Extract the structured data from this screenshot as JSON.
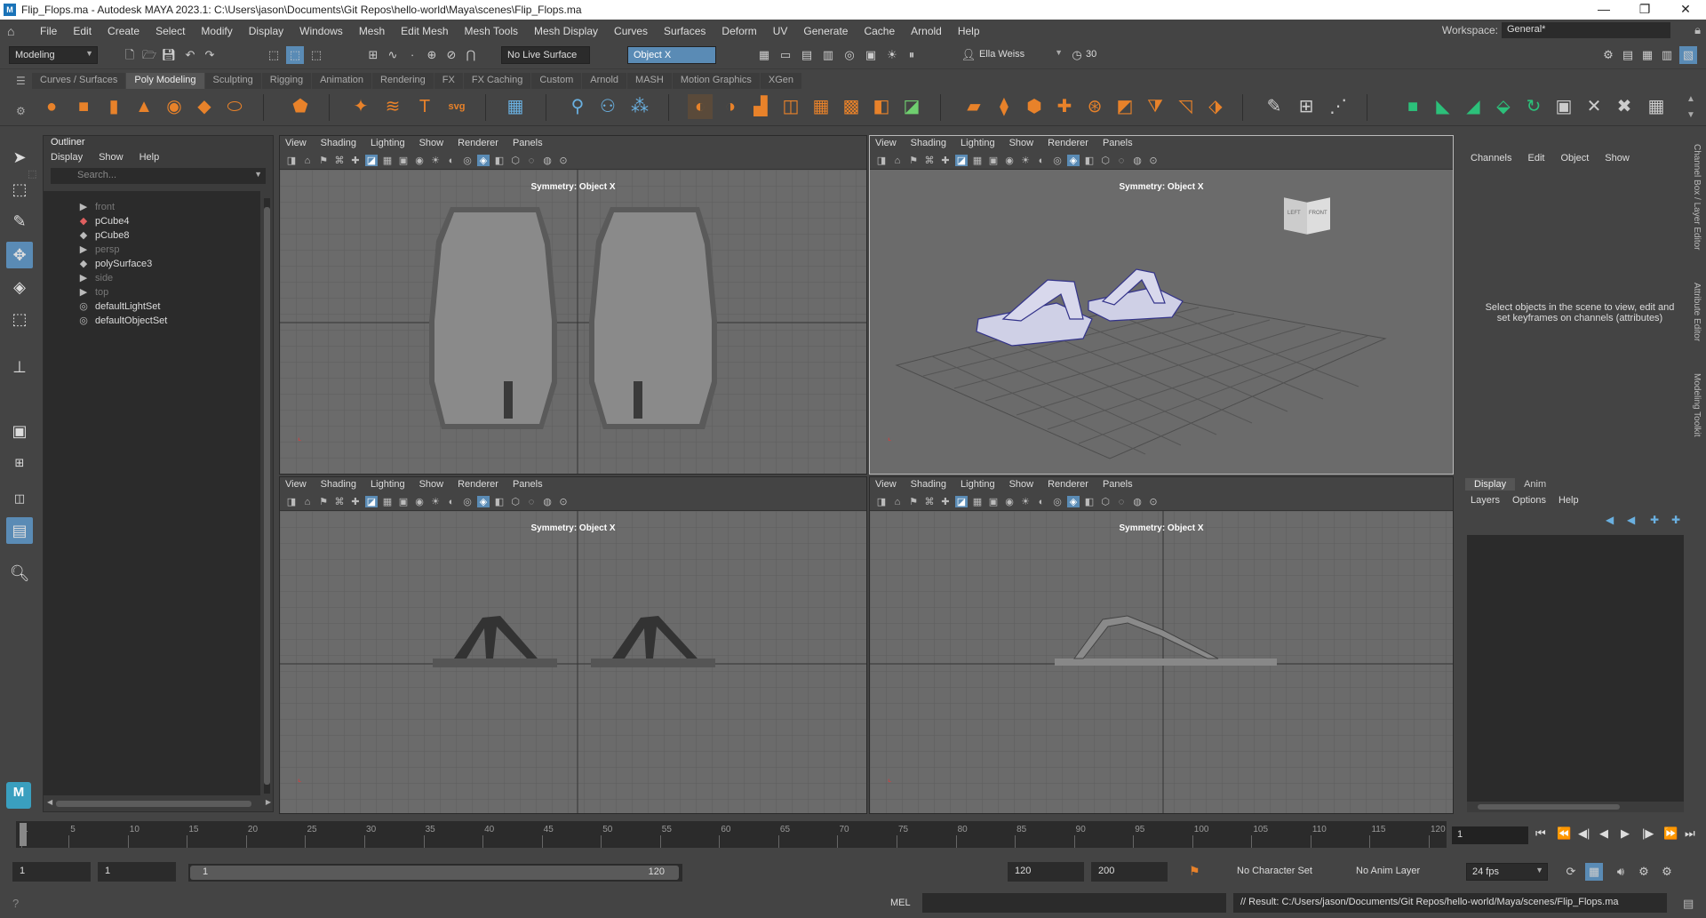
{
  "window": {
    "title": "Flip_Flops.ma - Autodesk MAYA 2023.1: C:\\Users\\jason\\Documents\\Git Repos\\hello-world\\Maya\\scenes\\Flip_Flops.ma",
    "minimize": "—",
    "maximize": "❐",
    "close": "✕"
  },
  "menubar": {
    "items": [
      "File",
      "Edit",
      "Create",
      "Select",
      "Modify",
      "Display",
      "Windows",
      "Mesh",
      "Edit Mesh",
      "Mesh Tools",
      "Mesh Display",
      "Curves",
      "Surfaces",
      "Deform",
      "UV",
      "Generate",
      "Cache",
      "Arnold",
      "Help"
    ],
    "workspace_label": "Workspace:",
    "workspace_value": "General*"
  },
  "statusline": {
    "mode": "Modeling",
    "live_surface": "No Live Surface",
    "symmetry": "Object X",
    "user": "Ella Weiss",
    "credits": "30"
  },
  "shelf": {
    "tabs": [
      "Curves / Surfaces",
      "Poly Modeling",
      "Sculpting",
      "Rigging",
      "Animation",
      "Rendering",
      "FX",
      "FX Caching",
      "Custom",
      "Arnold",
      "MASH",
      "Motion Graphics",
      "XGen"
    ],
    "active_tab": "Poly Modeling",
    "text_tool": "T",
    "svg_tool": "svg"
  },
  "outliner": {
    "title": "Outliner",
    "menus": [
      "Display",
      "Show",
      "Help"
    ],
    "search_placeholder": "Search...",
    "items": [
      {
        "label": "front",
        "dim": true,
        "icon": "camera-icon"
      },
      {
        "label": "pCube4",
        "dim": false,
        "icon": "mesh-icon"
      },
      {
        "label": "pCube8",
        "dim": false,
        "icon": "mesh-icon"
      },
      {
        "label": "persp",
        "dim": true,
        "icon": "camera-icon"
      },
      {
        "label": "polySurface3",
        "dim": false,
        "icon": "mesh-icon"
      },
      {
        "label": "side",
        "dim": true,
        "icon": "camera-icon"
      },
      {
        "label": "top",
        "dim": true,
        "icon": "camera-icon"
      },
      {
        "label": "defaultLightSet",
        "dim": false,
        "icon": "set-icon"
      },
      {
        "label": "defaultObjectSet",
        "dim": false,
        "icon": "set-icon"
      }
    ]
  },
  "viewport": {
    "menus": [
      "View",
      "Shading",
      "Lighting",
      "Show",
      "Renderer",
      "Panels"
    ],
    "symmetry_label": "Symmetry: Object X",
    "viewcube_left": "LEFT",
    "viewcube_front": "FRONT"
  },
  "channelbox": {
    "menus": [
      "Channels",
      "Edit",
      "Object",
      "Show"
    ],
    "message": "Select objects in the scene to view, edit and set keyframes on channels (attributes)",
    "side_tabs": [
      "Channel Box / Layer Editor",
      "Attribute Editor",
      "Modeling Toolkit"
    ]
  },
  "layereditor": {
    "tabs": [
      "Display",
      "Anim"
    ],
    "menus": [
      "Layers",
      "Options",
      "Help"
    ]
  },
  "timeline": {
    "ticks": [
      "1",
      "5",
      "10",
      "15",
      "20",
      "25",
      "30",
      "35",
      "40",
      "45",
      "50",
      "55",
      "60",
      "65",
      "70",
      "75",
      "80",
      "85",
      "90",
      "95",
      "100",
      "105",
      "110",
      "115",
      "120"
    ],
    "current_frame": "1"
  },
  "range": {
    "start": "1",
    "anim_start": "1",
    "slider_start": "1",
    "slider_end": "120",
    "end": "120",
    "anim_end": "200",
    "character_set": "No Character Set",
    "anim_layer": "No Anim Layer",
    "fps": "24 fps"
  },
  "commandline": {
    "language": "MEL",
    "result": "// Result: C:/Users/jason/Documents/Git Repos/hello-world/Maya/scenes/Flip_Flops.ma"
  }
}
